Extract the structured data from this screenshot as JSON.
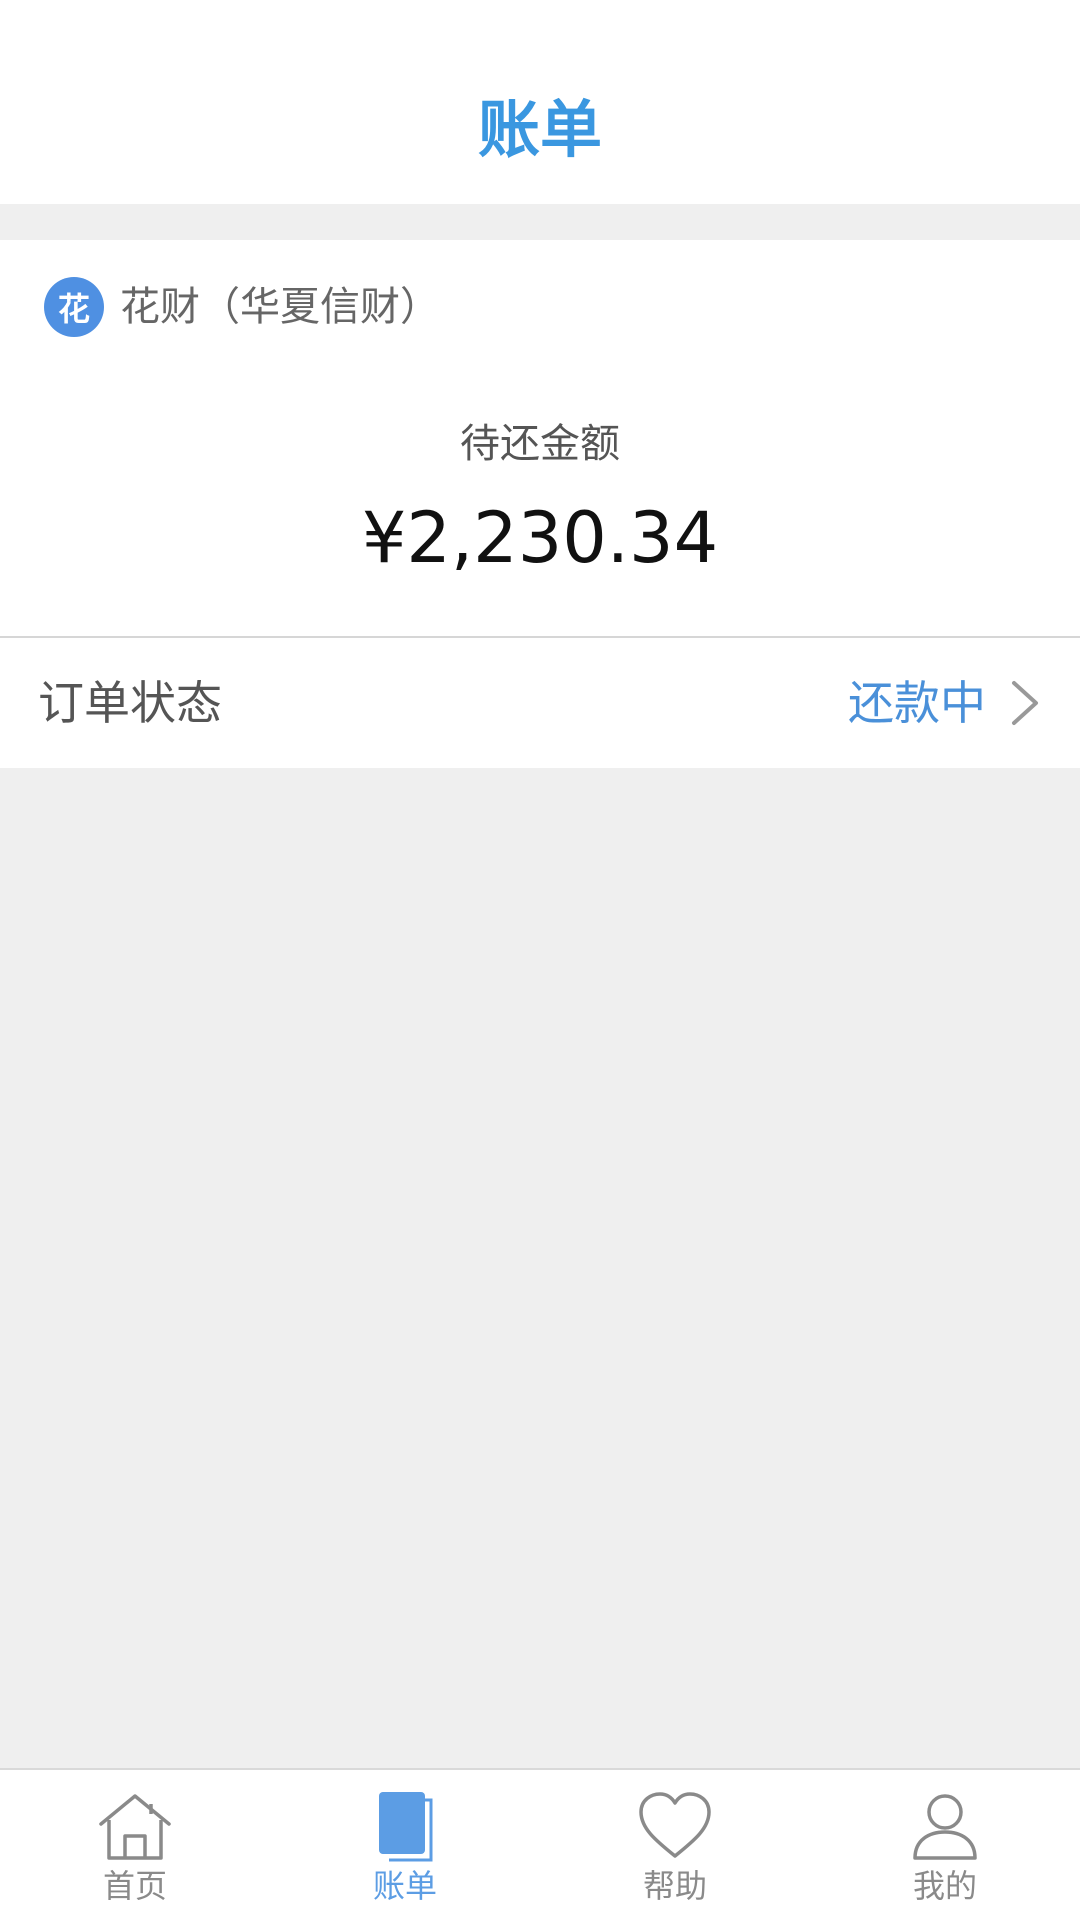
{
  "header": {
    "title": "账单"
  },
  "card": {
    "product_icon_char": "花",
    "product_name": "花财（华夏信财）",
    "amount_label": "待还金额",
    "amount_value": "¥2,230.34"
  },
  "status": {
    "label": "订单状态",
    "value": "还款中",
    "icon": "chevron-right-icon"
  },
  "colors": {
    "accent": "#3a97e0",
    "status_blue": "#4a90d9",
    "background": "#efefef"
  },
  "tabbar": {
    "tabs": [
      {
        "label": "首页",
        "icon": "home-icon",
        "active": false
      },
      {
        "label": "账单",
        "icon": "bill-icon",
        "active": true
      },
      {
        "label": "帮助",
        "icon": "heart-icon",
        "active": false
      },
      {
        "label": "我的",
        "icon": "user-icon",
        "active": false
      }
    ]
  }
}
